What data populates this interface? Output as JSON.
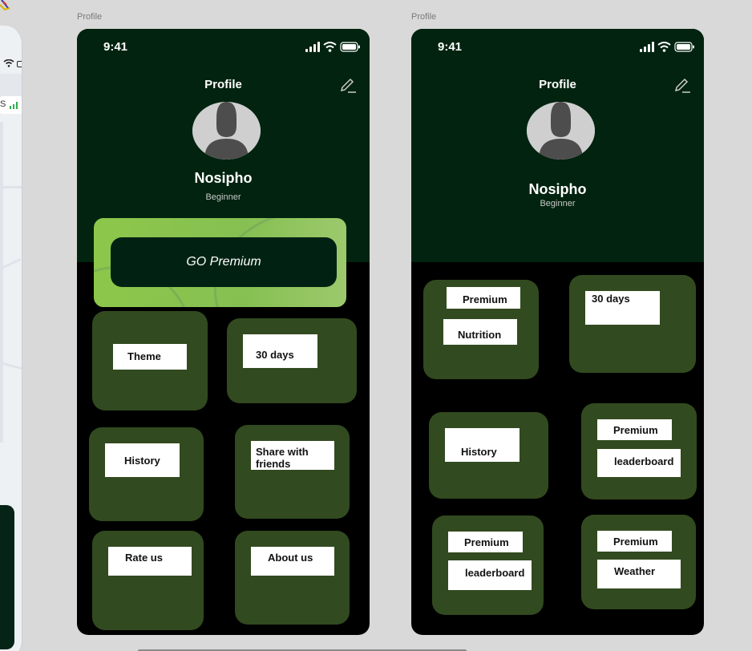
{
  "left_frame": {
    "label": "Profile",
    "time": "9:41",
    "title": "Profile",
    "name": "Nosipho",
    "level": "Beginner",
    "premium_button": "GO Premium",
    "tiles": [
      "Theme",
      "30 days",
      "History",
      "Share with friends",
      "Rate us",
      "About us"
    ]
  },
  "right_frame": {
    "label": "Profile",
    "time": "9:41",
    "title": "Profile",
    "name": "Nosipho",
    "level": "Beginner",
    "tile_labels": {
      "t1_a": "Premium",
      "t1_b": "Nutrition",
      "t2": "30 days",
      "t3": "History",
      "t4_a": "Premium",
      "t4_b": "leaderboard",
      "t5_a": "Premium",
      "t5_b": "leaderboard",
      "t6_a": "Premium",
      "t6_b": "Weather"
    }
  },
  "side_device": {
    "carrier_letter": "S"
  },
  "colors": {
    "canvas": "#d9d9d9",
    "header": "#01230f",
    "phone_bg": "#000000",
    "tile": "#324a1f",
    "premium_green": "#8dc74a"
  },
  "icons": [
    "signal-icon",
    "wifi-icon",
    "battery-icon",
    "edit-icon",
    "avatar-icon"
  ]
}
